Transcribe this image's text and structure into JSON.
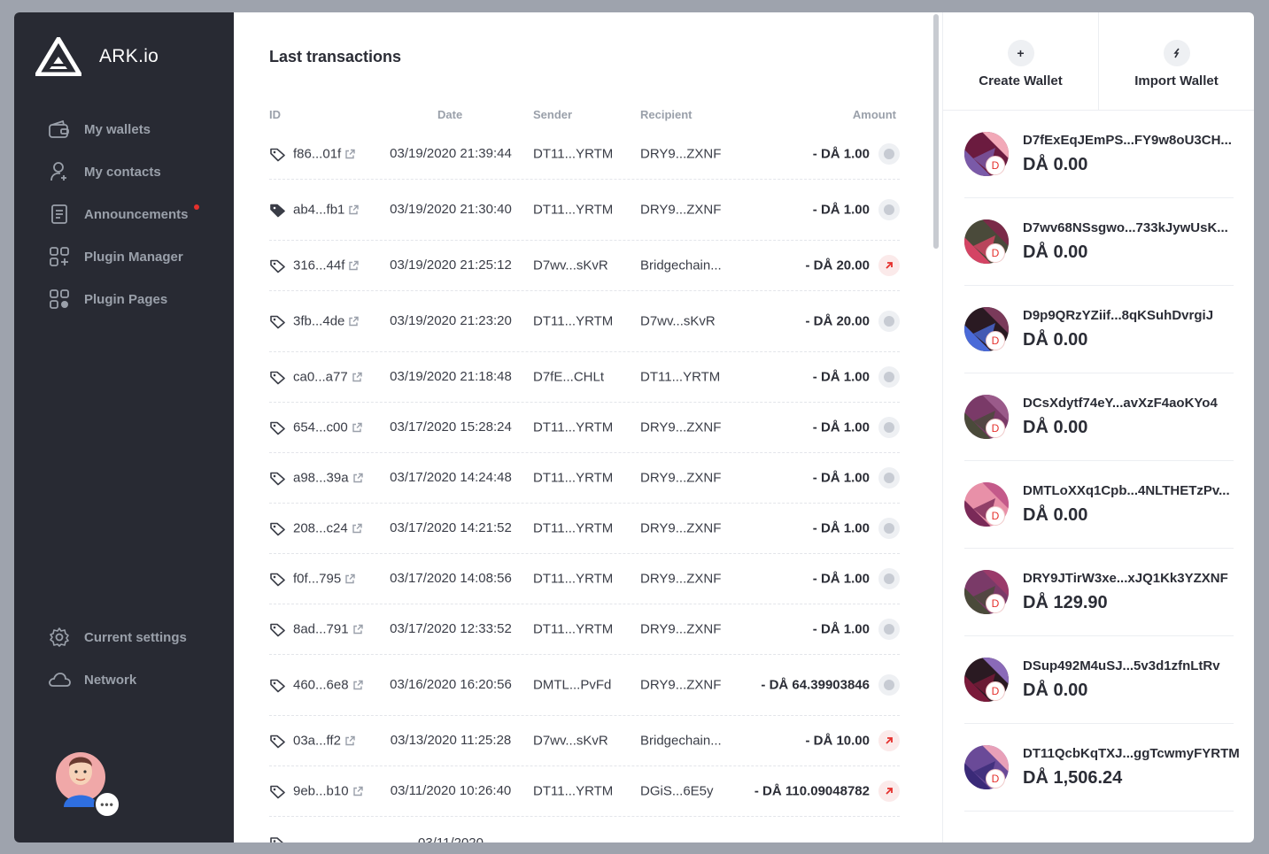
{
  "brand": {
    "name": "ARK.io"
  },
  "nav": {
    "items": [
      {
        "label": "My wallets",
        "icon": "wallet-icon"
      },
      {
        "label": "My contacts",
        "icon": "contacts-icon"
      },
      {
        "label": "Announcements",
        "icon": "announcements-icon",
        "unread": true
      },
      {
        "label": "Plugin Manager",
        "icon": "plugin-manager-icon"
      },
      {
        "label": "Plugin Pages",
        "icon": "plugin-pages-icon"
      }
    ],
    "bottom": [
      {
        "label": "Current settings",
        "icon": "gear-icon"
      },
      {
        "label": "Network",
        "icon": "cloud-icon"
      }
    ],
    "avatar_more": "•••"
  },
  "transactions": {
    "title": "Last transactions",
    "columns": {
      "id": "ID",
      "date": "Date",
      "sender": "Sender",
      "recipient": "Recipient",
      "amount": "Amount"
    },
    "rows": [
      {
        "id": "f86...01f",
        "date": "03/19/2020 21:39:44",
        "sender": "DT11...YRTM",
        "recipient": "DRY9...ZXNF",
        "amount": "- DÅ 1.00",
        "status": "self",
        "icon": "outline"
      },
      {
        "id": "ab4...fb1",
        "date": "03/19/2020 21:30:40",
        "sender": "DT11...YRTM",
        "recipient": "DRY9...ZXNF",
        "amount": "- DÅ 1.00",
        "status": "self",
        "icon": "filled"
      },
      {
        "id": "316...44f",
        "date": "03/19/2020 21:25:12",
        "sender": "D7wv...sKvR",
        "recipient": "Bridgechain...",
        "amount": "- DÅ 20.00",
        "status": "out",
        "icon": "outline"
      },
      {
        "id": "3fb...4de",
        "date": "03/19/2020 21:23:20",
        "sender": "DT11...YRTM",
        "recipient": "D7wv...sKvR",
        "amount": "- DÅ 20.00",
        "status": "self",
        "icon": "outline"
      },
      {
        "id": "ca0...a77",
        "date": "03/19/2020 21:18:48",
        "sender": "D7fE...CHLt",
        "recipient": "DT11...YRTM",
        "amount": "- DÅ 1.00",
        "status": "self",
        "icon": "outline"
      },
      {
        "id": "654...c00",
        "date": "03/17/2020 15:28:24",
        "sender": "DT11...YRTM",
        "recipient": "DRY9...ZXNF",
        "amount": "- DÅ 1.00",
        "status": "self",
        "icon": "outline"
      },
      {
        "id": "a98...39a",
        "date": "03/17/2020 14:24:48",
        "sender": "DT11...YRTM",
        "recipient": "DRY9...ZXNF",
        "amount": "- DÅ 1.00",
        "status": "self",
        "icon": "outline"
      },
      {
        "id": "208...c24",
        "date": "03/17/2020 14:21:52",
        "sender": "DT11...YRTM",
        "recipient": "DRY9...ZXNF",
        "amount": "- DÅ 1.00",
        "status": "self",
        "icon": "outline"
      },
      {
        "id": "f0f...795",
        "date": "03/17/2020 14:08:56",
        "sender": "DT11...YRTM",
        "recipient": "DRY9...ZXNF",
        "amount": "- DÅ 1.00",
        "status": "self",
        "icon": "outline"
      },
      {
        "id": "8ad...791",
        "date": "03/17/2020 12:33:52",
        "sender": "DT11...YRTM",
        "recipient": "DRY9...ZXNF",
        "amount": "- DÅ 1.00",
        "status": "self",
        "icon": "outline"
      },
      {
        "id": "460...6e8",
        "date": "03/16/2020 16:20:56",
        "sender": "DMTL...PvFd",
        "recipient": "DRY9...ZXNF",
        "amount": "- DÅ 64.39903846",
        "status": "self",
        "icon": "outline"
      },
      {
        "id": "03a...ff2",
        "date": "03/13/2020 11:25:28",
        "sender": "D7wv...sKvR",
        "recipient": "Bridgechain...",
        "amount": "- DÅ 10.00",
        "status": "out",
        "icon": "outline"
      },
      {
        "id": "9eb...b10",
        "date": "03/11/2020 10:26:40",
        "sender": "DT11...YRTM",
        "recipient": "DGiS...6E5y",
        "amount": "- DÅ 110.09048782",
        "status": "out",
        "icon": "outline"
      },
      {
        "id": "",
        "date": "03/11/2020",
        "sender": "",
        "recipient": "",
        "amount": "",
        "status": "partial",
        "icon": "outline"
      }
    ]
  },
  "actions": {
    "create": "Create Wallet",
    "import": "Import Wallet"
  },
  "wallets": [
    {
      "address": "D7fExEqJEmPS...FY9w8oU3CH...",
      "balance": "DÅ 0.00",
      "colors": [
        "#6b1b3f",
        "#7a5aa8",
        "#f2a9b8"
      ]
    },
    {
      "address": "D7wv68NSsgwo...733kJywUsK...",
      "balance": "DÅ 0.00",
      "colors": [
        "#4a4a3a",
        "#d44464",
        "#7a2a48"
      ]
    },
    {
      "address": "D9p9QRzYZiif...8qKSuhDvrgiJ",
      "balance": "DÅ 0.00",
      "colors": [
        "#2a1a22",
        "#4a6ad8",
        "#7a3a5a"
      ]
    },
    {
      "address": "DCsXdytf74eY...avXzF4aoKYo4",
      "balance": "DÅ 0.00",
      "colors": [
        "#7a3a68",
        "#4a4a3a",
        "#9a5a8a"
      ]
    },
    {
      "address": "DMTLoXXq1Cpb...4NLTHETzPv...",
      "balance": "DÅ 0.00",
      "colors": [
        "#e890a8",
        "#7a2a58",
        "#c45a8a"
      ]
    },
    {
      "address": "DRY9JTirW3xe...xJQ1Kk3YZXNF",
      "balance": "DÅ 129.90",
      "colors": [
        "#7a3a68",
        "#4a4a3a",
        "#9a3a6a"
      ]
    },
    {
      "address": "DSup492M4uSJ...5v3d1zfnLtRv",
      "balance": "DÅ 0.00",
      "colors": [
        "#2a1a22",
        "#7a1a3a",
        "#8a6ab8"
      ]
    },
    {
      "address": "DT11QcbKqTXJ...ggTcwmyFYRTM",
      "balance": "DÅ 1,506.24",
      "colors": [
        "#6a4a98",
        "#3a2a78",
        "#e8a0b8"
      ]
    }
  ],
  "wallet_badge": "D"
}
